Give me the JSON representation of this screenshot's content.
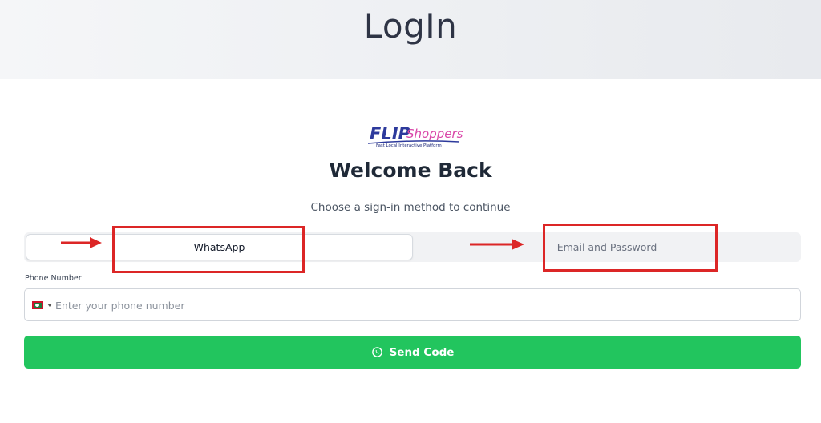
{
  "header": {
    "title": "LogIn"
  },
  "logo": {
    "flip": "FLIP",
    "shoppers": "Shoppers",
    "tagline": "Fast Local Interactive Platform"
  },
  "main": {
    "heading": "Welcome Back",
    "subtitle": "Choose a sign-in method to continue"
  },
  "tabs": [
    {
      "label": "WhatsApp",
      "active": true
    },
    {
      "label": "Email and Password",
      "active": false
    }
  ],
  "form": {
    "phone_label": "Phone Number",
    "phone_placeholder": "Enter your phone number",
    "phone_value": "",
    "send_label": "Send Code"
  },
  "icons": {
    "country_flag": "flag-icon",
    "send": "whatsapp-icon"
  },
  "colors": {
    "primary_button": "#22c55e",
    "annotation": "#dc2626",
    "logo_blue": "#2d3a9c",
    "logo_pink": "#d946a8"
  }
}
